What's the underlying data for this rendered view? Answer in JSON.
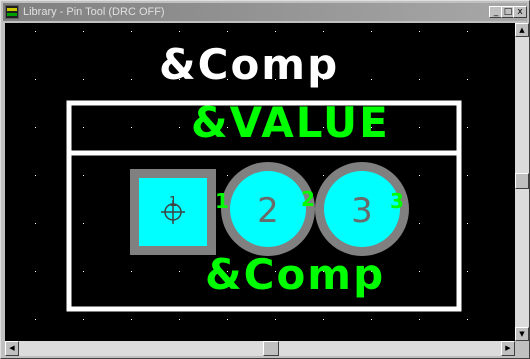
{
  "window": {
    "title": "Library - Pin Tool (DRC OFF)",
    "minimize_glyph": "_",
    "maximize_glyph": "□",
    "close_glyph": "x"
  },
  "canvas": {
    "background_color": "#000000",
    "grid_color": "#ffffff",
    "outline_color": "#ffffff",
    "pad_color": "#00ffff",
    "pad_ring_color": "#808080",
    "text_green": "#00ff00",
    "text_white": "#ffffff",
    "labels": {
      "comp_top": "&Comp",
      "value": "&VALUE",
      "comp_bottom": "&Comp"
    },
    "pins": [
      {
        "number": "1",
        "shape": "square"
      },
      {
        "number": "2",
        "shape": "round"
      },
      {
        "number": "3",
        "shape": "round"
      }
    ],
    "pin_markers": [
      "1",
      "2",
      "3"
    ]
  },
  "scrollbars": {
    "up_arrow": "▲",
    "down_arrow": "▼",
    "left_arrow": "◀",
    "right_arrow": "▶"
  }
}
